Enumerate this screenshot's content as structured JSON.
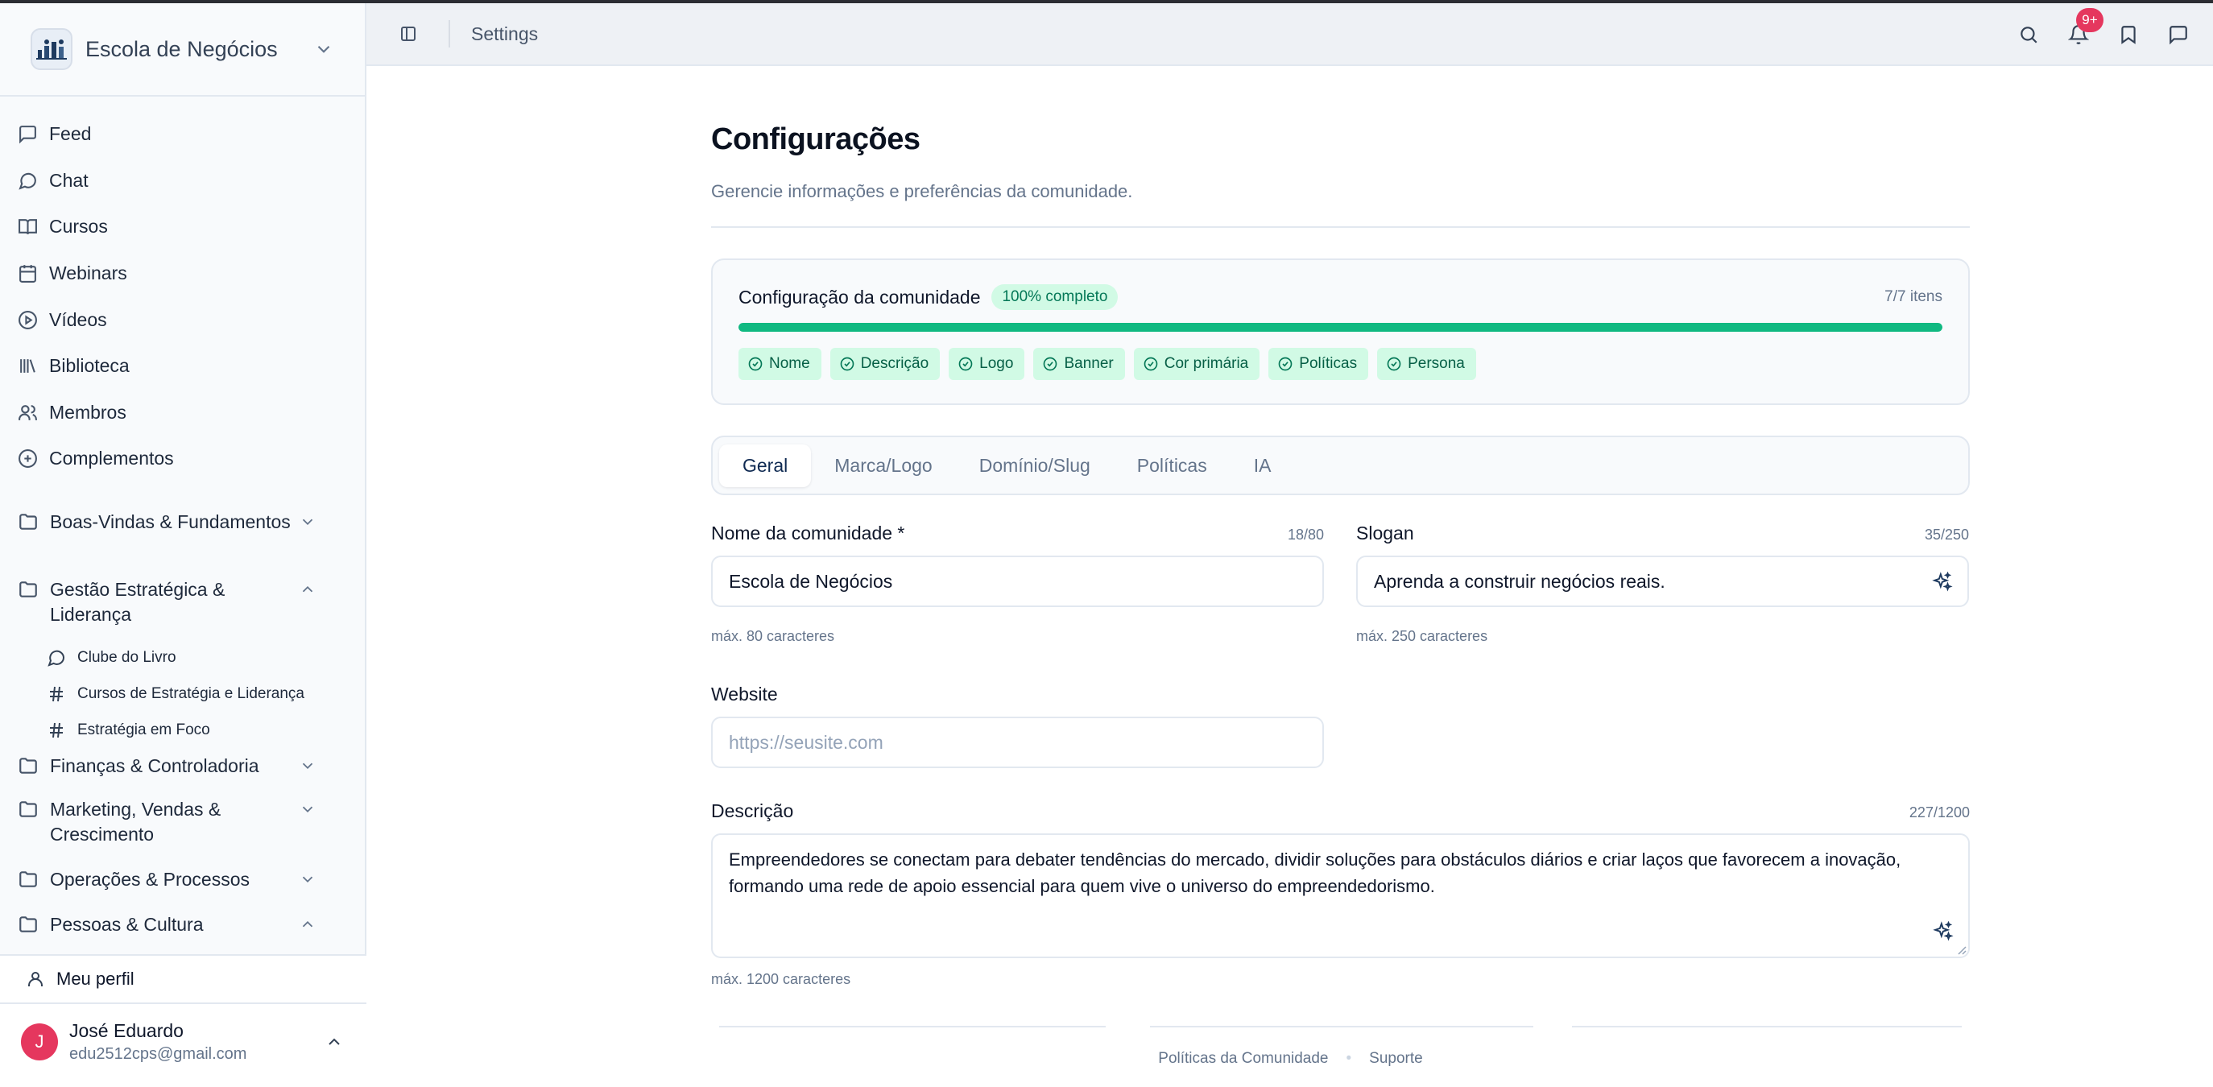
{
  "brand": {
    "name": "Escola de Negócios"
  },
  "nav": {
    "items": [
      {
        "label": "Feed",
        "icon": "message-square-icon"
      },
      {
        "label": "Chat",
        "icon": "message-circle-icon"
      },
      {
        "label": "Cursos",
        "icon": "book-open-icon"
      },
      {
        "label": "Webinars",
        "icon": "calendar-icon"
      },
      {
        "label": "Vídeos",
        "icon": "play-circle-icon"
      },
      {
        "label": "Biblioteca",
        "icon": "library-icon"
      },
      {
        "label": "Membros",
        "icon": "users-icon"
      },
      {
        "label": "Complementos",
        "icon": "plus-circle-icon"
      }
    ],
    "groups": [
      {
        "label": "Boas-Vindas & Fundamentos",
        "expanded": false
      },
      {
        "label": "Gestão Estratégica & Liderança",
        "expanded": true,
        "children": [
          {
            "label": "Clube do Livro",
            "icon": "message-circle-icon"
          },
          {
            "label": "Cursos de Estratégia e Liderança",
            "icon": "hash-icon"
          },
          {
            "label": "Estratégia em Foco",
            "icon": "hash-icon"
          }
        ]
      },
      {
        "label": "Finanças & Controladoria",
        "expanded": false
      },
      {
        "label": "Marketing, Vendas & Crescimento",
        "expanded": false
      },
      {
        "label": "Operações & Processos",
        "expanded": false
      },
      {
        "label": "Pessoas & Cultura",
        "expanded": true
      }
    ]
  },
  "sidebar_bottom": {
    "profile_label": "Meu perfil",
    "user": {
      "initial": "J",
      "name": "José Eduardo",
      "email": "edu2512cps@gmail.com"
    }
  },
  "topbar": {
    "breadcrumb": "Settings",
    "notification_count": "9+"
  },
  "page": {
    "title": "Configurações",
    "subtitle": "Gerencie informações e preferências da comunidade."
  },
  "setup": {
    "title": "Configuração da comunidade",
    "status": "100% completo",
    "count": "7/7 itens",
    "progress": 1.0,
    "items": [
      "Nome",
      "Descrição",
      "Logo",
      "Banner",
      "Cor primária",
      "Políticas",
      "Persona"
    ]
  },
  "tabs": [
    {
      "label": "Geral",
      "active": true
    },
    {
      "label": "Marca/Logo",
      "active": false
    },
    {
      "label": "Domínio/Slug",
      "active": false
    },
    {
      "label": "Políticas",
      "active": false
    },
    {
      "label": "IA",
      "active": false
    }
  ],
  "form": {
    "name": {
      "label": "Nome da comunidade *",
      "counter": "18/80",
      "value": "Escola de Negócios",
      "hint": "máx. 80 caracteres"
    },
    "slogan": {
      "label": "Slogan",
      "counter": "35/250",
      "value": "Aprenda a construir negócios reais.",
      "hint": "máx. 250 caracteres"
    },
    "website": {
      "label": "Website",
      "placeholder": "https://seusite.com"
    },
    "description": {
      "label": "Descrição",
      "counter": "227/1200",
      "value": "Empreendedores se conectam para debater tendências do mercado, dividir soluções para obstáculos diários e criar laços que favorecem a inovação, formando uma rede de apoio essencial para quem vive o universo do empreendedorismo.",
      "hint": "máx. 1200 caracteres"
    }
  },
  "footer": {
    "links": [
      "Políticas da Comunidade",
      "Suporte"
    ]
  },
  "colors": {
    "accent": "#10b981",
    "badge": "#e5375e",
    "avatar": "#e5375e"
  }
}
